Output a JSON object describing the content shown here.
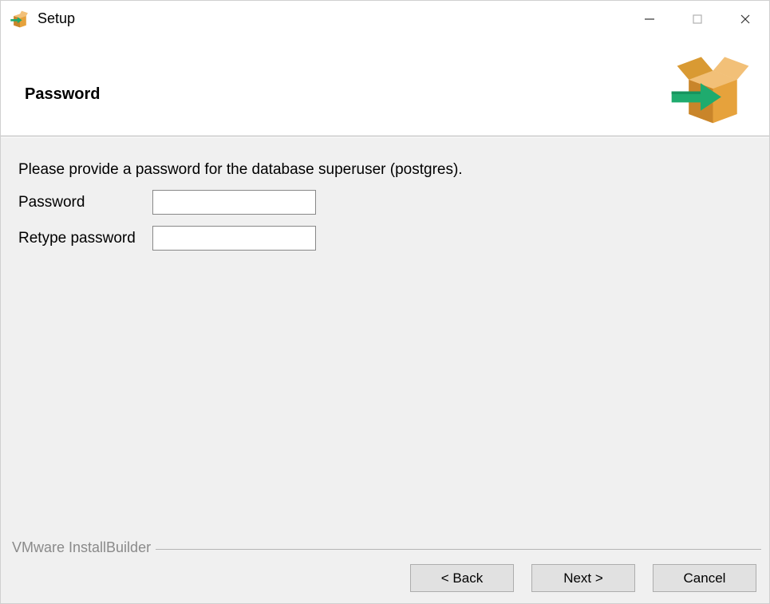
{
  "titlebar": {
    "title": "Setup"
  },
  "header": {
    "page_title": "Password"
  },
  "body": {
    "instruction": "Please provide a password for the database superuser (postgres).",
    "password_label": "Password",
    "retype_label": "Retype password",
    "password_value": "",
    "retype_value": ""
  },
  "footer": {
    "frame_label": "VMware InstallBuilder",
    "back_label": "< Back",
    "next_label": "Next >",
    "cancel_label": "Cancel"
  },
  "colors": {
    "box_orange": "#e6a23c",
    "box_orange_dark": "#c9852a",
    "arrow_green": "#1fab6e"
  }
}
